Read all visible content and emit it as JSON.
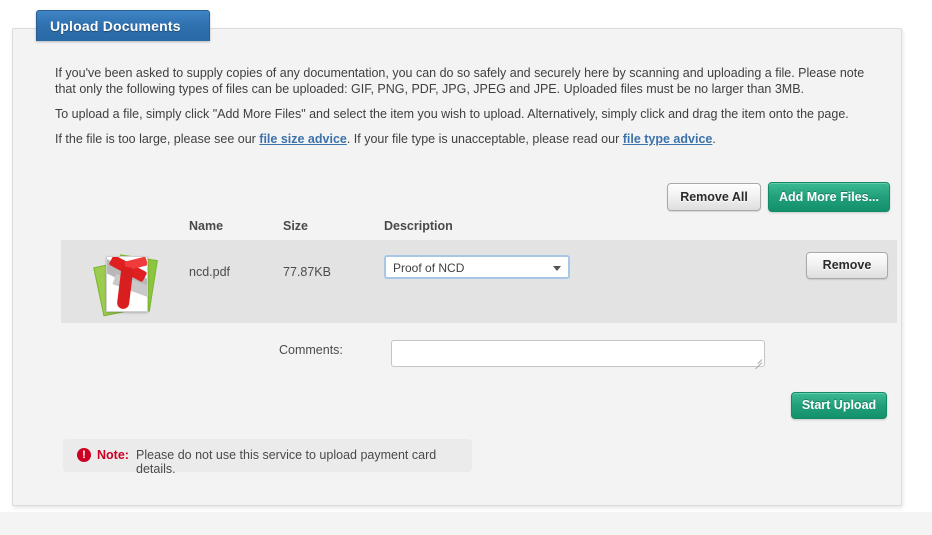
{
  "tab": {
    "label": "Upload Documents"
  },
  "intro": {
    "paragraph1_part1": "If you've been asked to supply copies of any documentation, you can do so safely and securely here by scanning and uploading a file. Please note that only the following types of files can be uploaded: GIF, PNG, PDF, JPG, JPEG and JPE. Uploaded files must be no larger than 3MB.",
    "paragraph2": "To upload a file, simply click \"Add More Files\" and select the item you wish to upload. Alternatively, simply click and drag the item onto the page.",
    "paragraph3_before": "If the file is too large, please see our ",
    "link_size": "file size advice",
    "paragraph3_middle": ". If your file type is unacceptable, please read our ",
    "link_type": "file type advice",
    "paragraph3_after": "."
  },
  "actions": {
    "remove_all": "Remove All",
    "add_more_files": "Add More Files...",
    "start_upload": "Start Upload"
  },
  "table": {
    "headers": {
      "name": "Name",
      "size": "Size",
      "description": "Description"
    },
    "rows": [
      {
        "file_icon": "pdf-file-icon",
        "name": "ncd.pdf",
        "size": "77.87KB",
        "description_selected": "Proof of NCD",
        "remove_label": "Remove"
      }
    ]
  },
  "comments": {
    "label": "Comments:",
    "value": "",
    "placeholder": ""
  },
  "note": {
    "icon": "exclamation-icon",
    "icon_glyph": "!",
    "word": "Note:",
    "text": "Please do not use this service to upload payment card details."
  },
  "colors": {
    "tab_blue": "#2e6fad",
    "button_green": "#22a07c",
    "link_blue": "#3c72ab",
    "note_red": "#cc0022",
    "row_grey": "#e3e3e3",
    "panel_grey": "#f3f3f3"
  }
}
